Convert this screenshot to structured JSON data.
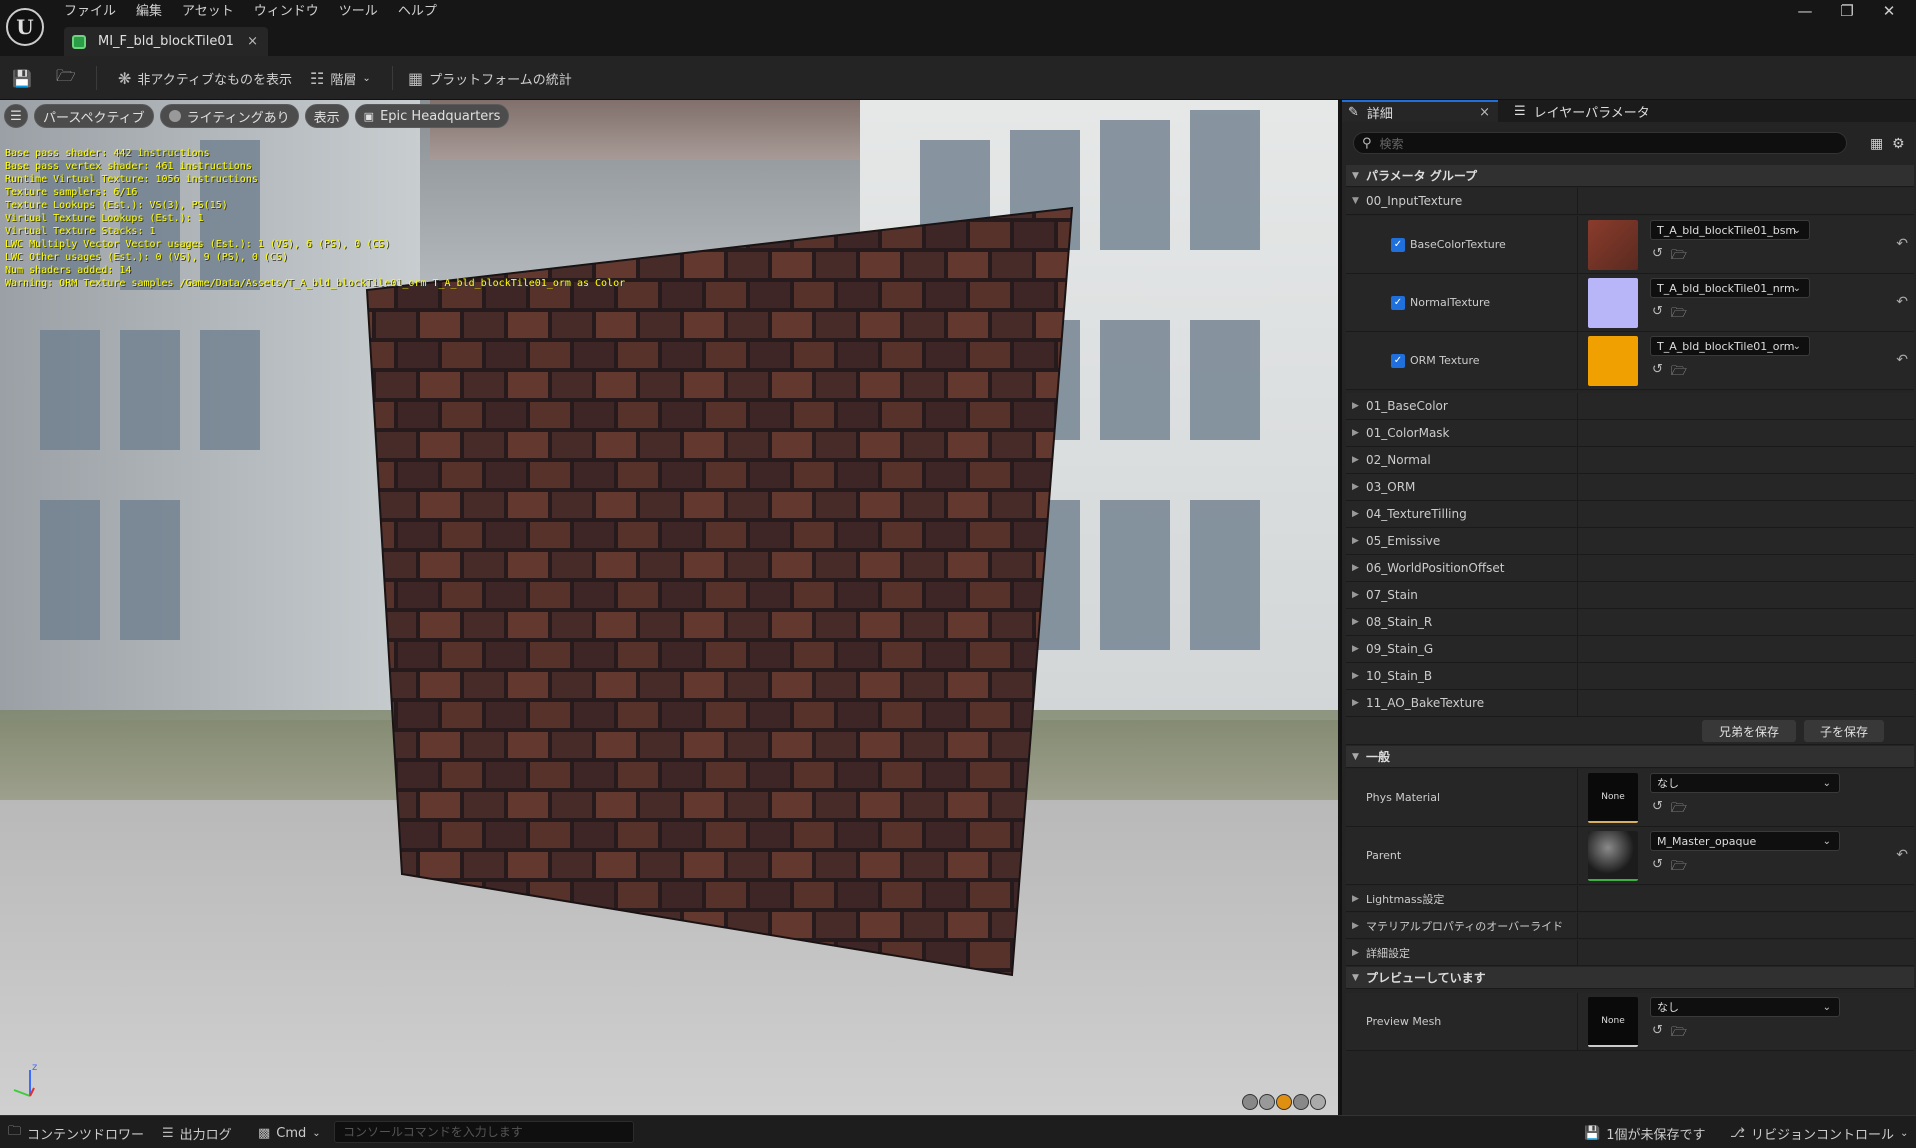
{
  "window": {
    "logo": "U",
    "menu": [
      "ファイル",
      "編集",
      "アセット",
      "ウィンドウ",
      "ツール",
      "ヘルプ"
    ],
    "controls": [
      "—",
      "❐",
      "✕"
    ],
    "doc_tab": {
      "label": "MI_F_bld_blockTile01",
      "close": "×"
    }
  },
  "toolbar": {
    "show_inactive": "非アクティブなものを表示",
    "hierarchy": "階層",
    "platform_stats": "プラットフォームの統計"
  },
  "viewport": {
    "perspective": "パースペクティブ",
    "lighting": "ライティングあり",
    "show": "表示",
    "preview_scene": "Epic Headquarters",
    "stats": [
      "Base pass shader: 442 instructions",
      "Base pass vertex shader: 461 instructions",
      "Runtime Virtual Texture: 1056 instructions",
      "Texture samplers: 6/16",
      "Texture Lookups (Est.): VS(3), PS(15)",
      "Virtual Texture Lookups (Est.): 1",
      "Virtual Texture Stacks: 1",
      "LWC Multiply Vector Vector usages (Est.): 1 (VS), 6 (PS), 0 (CS)",
      "LWC Other usages (Est.): 0 (VS), 9 (PS), 0 (CS)",
      "Num shaders added: 14",
      "Warning: ORM Texture samples /Game/Data/Assets/T_A_bld_blockTile01_orm T_A_bld_blockTile01_orm as Color"
    ]
  },
  "details": {
    "tab_details": "詳細",
    "tab_details_close": "×",
    "tab_layer": "レイヤーパラメータ",
    "search_placeholder": "検索",
    "param_group": "パラメータ グループ",
    "input_texture": "00_InputTexture",
    "textures": [
      {
        "label": "BaseColorTexture",
        "value": "T_A_bld_blockTile01_bsm",
        "color": "#8a3c2c"
      },
      {
        "label": "NormalTexture",
        "value": "T_A_bld_blockTile01_nrm",
        "color": "#b8b6f8"
      },
      {
        "label": "ORM Texture",
        "value": "T_A_bld_blockTile01_orm",
        "color": "#f0a000"
      }
    ],
    "groups": [
      "01_BaseColor",
      "01_ColorMask",
      "02_Normal",
      "03_ORM",
      "04_TextureTilling",
      "05_Emissive",
      "06_WorldPositionOffset",
      "07_Stain",
      "08_Stain_R",
      "09_Stain_G",
      "10_Stain_B",
      "11_AO_BakeTexture"
    ],
    "save_sibling": "兄弟を保存",
    "save_child": "子を保存",
    "general": "一般",
    "phys_material": {
      "label": "Phys Material",
      "thumb": "None",
      "value": "なし"
    },
    "parent": {
      "label": "Parent",
      "value": "M_Master_opaque"
    },
    "lightmass": "Lightmass設定",
    "material_override": "マテリアルプロパティのオーバーライド",
    "advanced": "詳細設定",
    "previewing": "プレビューしています",
    "preview_mesh": {
      "label": "Preview Mesh",
      "thumb": "None",
      "value": "なし"
    }
  },
  "statusbar": {
    "content_drawer": "コンテンツドロワー",
    "output_log": "出力ログ",
    "cmd": "Cmd",
    "console_placeholder": "コンソールコマンドを入力します",
    "unsaved": "1個が未保存です",
    "revision": "リビジョンコントロール"
  },
  "colors": {
    "accent": "#1f6fdc",
    "stats_text": "#ffff00"
  }
}
